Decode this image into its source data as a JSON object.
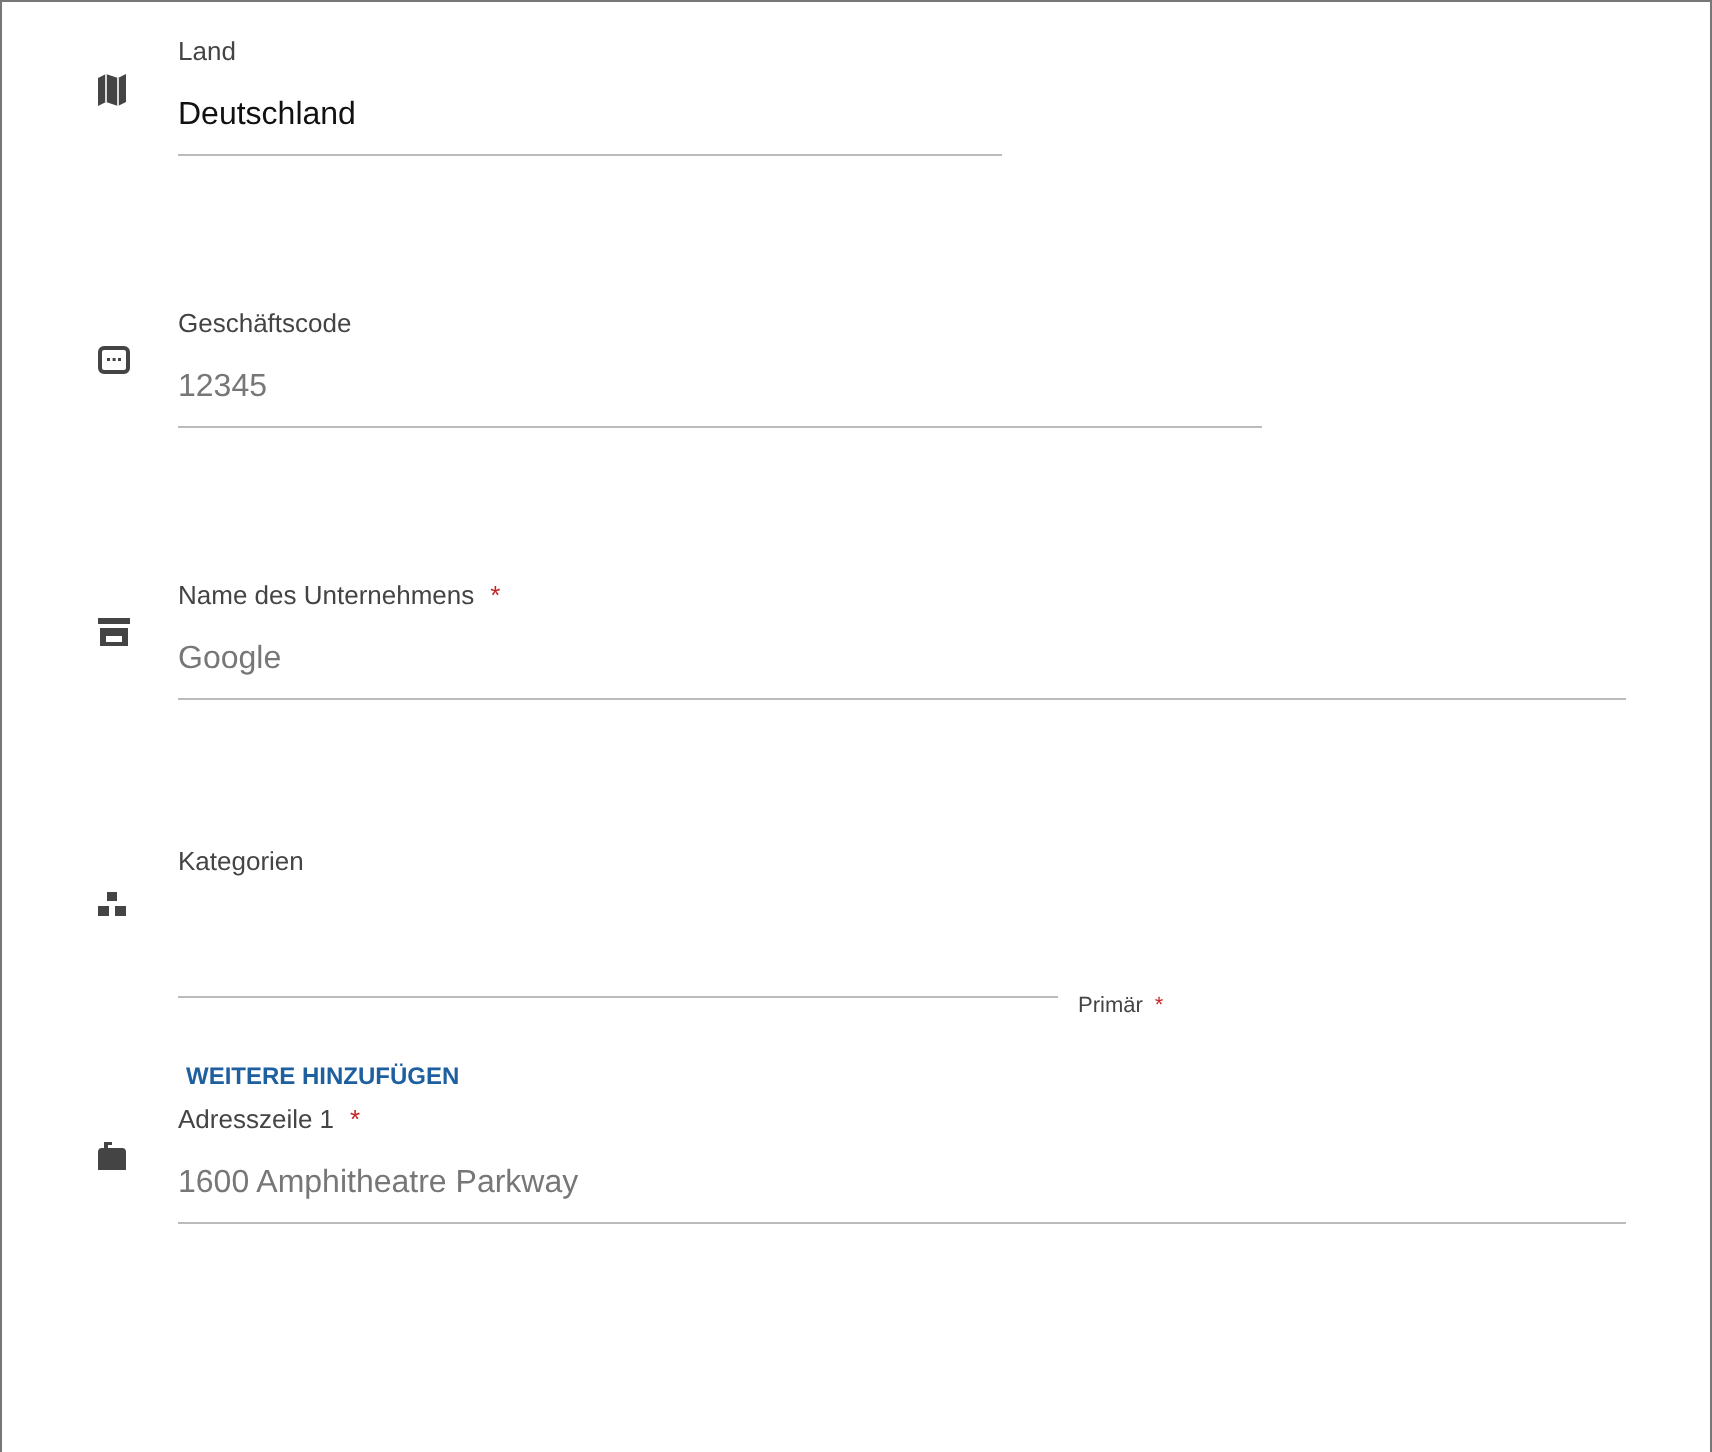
{
  "fields": [
    {
      "label": "Land",
      "value": "Deutschland"
    },
    {
      "label": "Geschäftscode",
      "placeholder": "12345"
    },
    {
      "label": "Name des Unternehmens",
      "mark": "*",
      "placeholder": "Google"
    },
    {
      "label": "Kategorien",
      "side_label": "Primär",
      "side_mark": "*",
      "action": "WEITERE HINZUFÜGEN"
    },
    {
      "label": "Adresszeile 1",
      "mark": "*",
      "placeholder": "1600 Amphitheatre Parkway"
    }
  ]
}
